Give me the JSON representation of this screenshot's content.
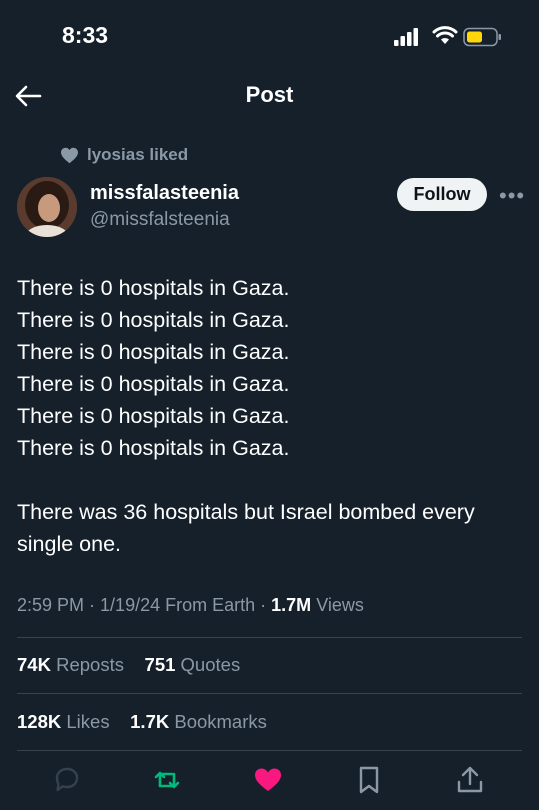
{
  "status_bar": {
    "time": "8:33"
  },
  "header": {
    "title": "Post"
  },
  "social_context": {
    "text": "lyosias liked"
  },
  "author": {
    "display_name": "missfalasteenia",
    "handle": "@missfalsteenia"
  },
  "follow_label": "Follow",
  "tweet": {
    "lines": [
      "There is 0 hospitals in Gaza.",
      "There is 0 hospitals in Gaza.",
      "There is 0 hospitals in Gaza.",
      "There is 0 hospitals in Gaza.",
      "There is 0 hospitals in Gaza.",
      "There is 0 hospitals in Gaza."
    ],
    "paragraph_2": [
      "There was 36 hospitals but Israel bombed every",
      "single one."
    ]
  },
  "meta": {
    "time": "2:59 PM",
    "date": "1/19/24",
    "source": "From Earth",
    "views_count": "1.7M",
    "views_label": "Views"
  },
  "stats": {
    "reposts_count": "74K",
    "reposts_label": "Reposts",
    "quotes_count": "751",
    "quotes_label": "Quotes",
    "likes_count": "128K",
    "likes_label": "Likes",
    "bookmarks_count": "1.7K",
    "bookmarks_label": "Bookmarks"
  },
  "colors": {
    "background": "#15202b",
    "muted": "#8b98a5",
    "repost_green": "#00ba7c",
    "like_pink": "#f91880",
    "battery_yellow": "#ffd60a"
  },
  "icons": [
    "back-arrow-icon",
    "heart-icon",
    "more-icon",
    "reply-icon",
    "repost-icon",
    "like-icon",
    "bookmark-icon",
    "share-icon"
  ]
}
